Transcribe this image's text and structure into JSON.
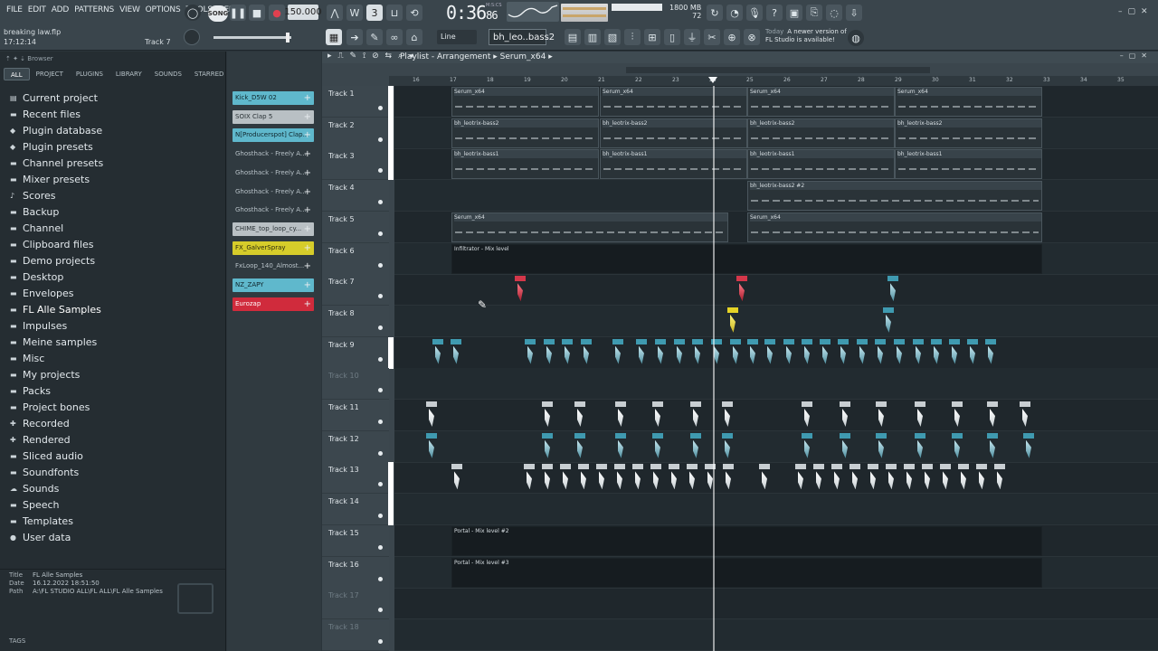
{
  "menu": [
    "FILE",
    "EDIT",
    "ADD",
    "PATTERNS",
    "VIEW",
    "OPTIONS",
    "TOOLS",
    "HELP"
  ],
  "toolbar": {
    "song_mode": "SONG",
    "tempo": "150.000",
    "time": "0:36",
    "time_frac": "86",
    "time_unit": "M:S:CS",
    "cpu_value": "46",
    "memory": "1800 MB",
    "poly": "72",
    "snap": "Line",
    "pattern": "bh_leo..bass2",
    "news_today": "Today",
    "news_text": "A newer version of FL Studio is available!"
  },
  "project": {
    "filename": "breaking law.flp",
    "clock": "17:12:14",
    "hint": "Track 7"
  },
  "browser": {
    "title": "Browser",
    "tabs": [
      "ALL",
      "PROJECT",
      "PLUGINS",
      "LIBRARY",
      "SOUNDS",
      "STARRED"
    ],
    "active_tab": "ALL",
    "items": [
      {
        "label": "Current project",
        "icon": "project-icon"
      },
      {
        "label": "Recent files",
        "icon": "folder-icon"
      },
      {
        "label": "Plugin database",
        "icon": "plugin-icon"
      },
      {
        "label": "Plugin presets",
        "icon": "plugin-icon"
      },
      {
        "label": "Channel presets",
        "icon": "folder-icon"
      },
      {
        "label": "Mixer presets",
        "icon": "folder-icon"
      },
      {
        "label": "Scores",
        "icon": "note-icon"
      },
      {
        "label": "Backup",
        "icon": "folder-icon"
      },
      {
        "label": "Channel",
        "icon": "folder-icon"
      },
      {
        "label": "Clipboard files",
        "icon": "folder-icon"
      },
      {
        "label": "Demo projects",
        "icon": "folder-icon"
      },
      {
        "label": "Desktop",
        "icon": "folder-icon"
      },
      {
        "label": "Envelopes",
        "icon": "folder-icon"
      },
      {
        "label": "FL Alle Samples",
        "icon": "folder-icon"
      },
      {
        "label": "Impulses",
        "icon": "folder-icon"
      },
      {
        "label": "Meine samples",
        "icon": "folder-icon"
      },
      {
        "label": "Misc",
        "icon": "folder-icon"
      },
      {
        "label": "My projects",
        "icon": "folder-icon"
      },
      {
        "label": "Packs",
        "icon": "folder-icon"
      },
      {
        "label": "Project bones",
        "icon": "folder-icon"
      },
      {
        "label": "Recorded",
        "icon": "plus-icon"
      },
      {
        "label": "Rendered",
        "icon": "plus-icon"
      },
      {
        "label": "Sliced audio",
        "icon": "folder-icon"
      },
      {
        "label": "Soundfonts",
        "icon": "folder-icon"
      },
      {
        "label": "Sounds",
        "icon": "cloud-icon"
      },
      {
        "label": "Speech",
        "icon": "folder-icon"
      },
      {
        "label": "Templates",
        "icon": "folder-icon"
      },
      {
        "label": "User data",
        "icon": "user-icon"
      }
    ],
    "info": {
      "title_key": "Title",
      "title": "FL Alle Samples",
      "date_key": "Date",
      "date": "16.12.2022 18:51:50",
      "path_key": "Path",
      "path": "A:\\FL STUDIO ALL\\FL ALL\\FL Alle Samples"
    },
    "tags_label": "TAGS"
  },
  "channels": [
    {
      "label": "Kick_D5W 02",
      "color": "#5fb8cc",
      "text": "#10252b"
    },
    {
      "label": "SOIX Clap 5",
      "color": "#b9c0c4",
      "text": "#2a3236"
    },
    {
      "label": "N[Producerspot] Clap...",
      "color": "#5fb8cc",
      "text": "#10252b"
    },
    {
      "label": "Ghosthack - Freely A...",
      "color": "transparent",
      "text": "#b8c2c8"
    },
    {
      "label": "Ghosthack - Freely A...",
      "color": "transparent",
      "text": "#b8c2c8"
    },
    {
      "label": "Ghosthack - Freely A...",
      "color": "transparent",
      "text": "#b8c2c8"
    },
    {
      "label": "Ghosthack - Freely A...",
      "color": "transparent",
      "text": "#b8c2c8"
    },
    {
      "label": "CHIME_top_loop_cy...",
      "color": "#b9c0c4",
      "text": "#2a3236"
    },
    {
      "label": "FX_GalverSpray",
      "color": "#d6cc2a",
      "text": "#2a2a10"
    },
    {
      "label": "FxLoop_140_Almost...",
      "color": "transparent",
      "text": "#b8c2c8"
    },
    {
      "label": "NZ_ZAPY",
      "color": "#5fb8cc",
      "text": "#10252b"
    },
    {
      "label": "Eurozap",
      "color": "#d02b3c",
      "text": "#ffffff"
    }
  ],
  "playlist": {
    "title": "Playlist - Arrangement",
    "pattern": "Serum_x64",
    "ruler": [
      "16",
      "17",
      "18",
      "19",
      "20",
      "21",
      "22",
      "23",
      "24",
      "25",
      "26",
      "27",
      "28",
      "29",
      "30",
      "31",
      "32",
      "33",
      "34",
      "35"
    ],
    "tracks": [
      {
        "label": "Track 1"
      },
      {
        "label": "Track 2"
      },
      {
        "label": "Track 3"
      },
      {
        "label": "Track 4"
      },
      {
        "label": "Track 5"
      },
      {
        "label": "Track 6"
      },
      {
        "label": "Track 7"
      },
      {
        "label": "Track 8"
      },
      {
        "label": "Track 9"
      },
      {
        "label": "Track 10"
      },
      {
        "label": "Track 11"
      },
      {
        "label": "Track 12"
      },
      {
        "label": "Track 13"
      },
      {
        "label": "Track 14"
      },
      {
        "label": "Track 15"
      },
      {
        "label": "Track 16"
      },
      {
        "label": "Track 17"
      },
      {
        "label": "Track 18"
      }
    ],
    "clip_labels": {
      "serum": "Serum_x64",
      "bass2": "bh_leotrix-bass2",
      "bass1": "bh_leotrix-bass1",
      "bass2_2": "bh_leotrix-bass2 #2",
      "infiltrator": "Infiltrator - Mix level",
      "portal": "Portal - Mix level #2",
      "portal2": "Portal - Mix level #2",
      "portal3": "Portal - Mix level #3"
    }
  }
}
